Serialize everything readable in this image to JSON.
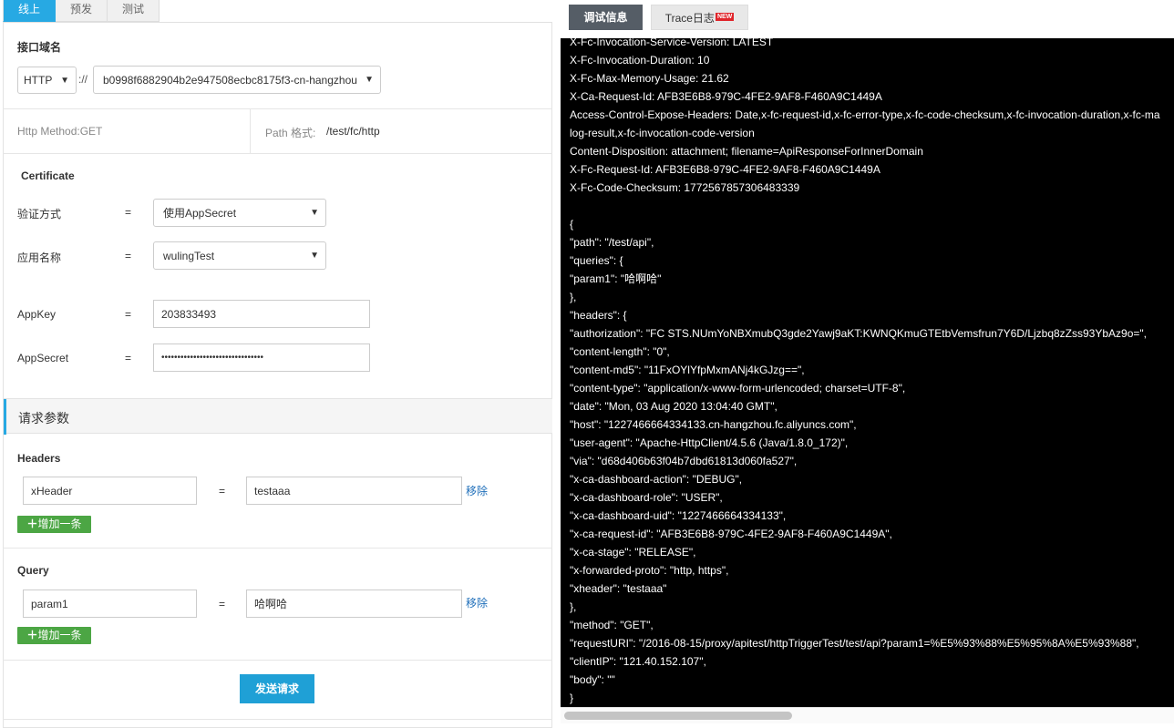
{
  "left": {
    "tabs": [
      "线上",
      "预发",
      "测试"
    ],
    "domain": {
      "title": "接口域名",
      "protocol": "HTTP",
      "separator": "://",
      "host": "b0998f6882904b2e947508ecbc8175f3-cn-hangzhou"
    },
    "method_label": "Http Method:GET",
    "path_label": "Path 格式:",
    "path_value": "/test/fc/http",
    "certificate": {
      "title": "Certificate",
      "auth_label": "验证方式",
      "auth_value": "使用AppSecret",
      "app_label": "应用名称",
      "app_value": "wulingTest",
      "appkey_label": "AppKey",
      "appkey_value": "203833493",
      "appsecret_label": "AppSecret",
      "appsecret_value": "••••••••••••••••••••••••••••••••",
      "eq": "="
    },
    "params": {
      "title": "请求参数",
      "headers_title": "Headers",
      "header_key": "xHeader",
      "header_value": "testaaa",
      "query_title": "Query",
      "query_key": "param1",
      "query_value": "哈啊哈",
      "remove_label": "移除",
      "add_label": "增加一条",
      "add_icon": "plus-icon"
    },
    "send_label": "发送请求"
  },
  "right": {
    "tab_debug": "调试信息",
    "tab_trace": "Trace日志",
    "new_badge": "NEW",
    "lines": [
      "X-Fc-Invocation-Service-Version: LATEST",
      "X-Fc-Invocation-Duration: 10",
      "X-Fc-Max-Memory-Usage: 21.62",
      "X-Ca-Request-Id: AFB3E6B8-979C-4FE2-9AF8-F460A9C1449A",
      "Access-Control-Expose-Headers: Date,x-fc-request-id,x-fc-error-type,x-fc-code-checksum,x-fc-invocation-duration,x-fc-ma",
      "log-result,x-fc-invocation-code-version",
      "Content-Disposition: attachment; filename=ApiResponseForInnerDomain",
      "X-Fc-Request-Id: AFB3E6B8-979C-4FE2-9AF8-F460A9C1449A",
      "X-Fc-Code-Checksum: 1772567857306483339",
      "",
      "{",
      "\"path\": \"/test/api\",",
      "\"queries\": {",
      "\"param1\": \"哈啊哈\"",
      "},",
      "\"headers\": {",
      "\"authorization\": \"FC STS.NUmYoNBXmubQ3gde2Yawj9aKT:KWNQKmuGTEtbVemsfrun7Y6D/Ljzbq8zZss93YbAz9o=\",",
      "\"content-length\": \"0\",",
      "\"content-md5\": \"11FxOYlYfpMxmANj4kGJzg==\",",
      "\"content-type\": \"application/x-www-form-urlencoded; charset=UTF-8\",",
      "\"date\": \"Mon, 03 Aug 2020 13:04:40 GMT\",",
      "\"host\": \"1227466664334133.cn-hangzhou.fc.aliyuncs.com\",",
      "\"user-agent\": \"Apache-HttpClient/4.5.6 (Java/1.8.0_172)\",",
      "\"via\": \"d68d406b63f04b7dbd61813d060fa527\",",
      "\"x-ca-dashboard-action\": \"DEBUG\",",
      "\"x-ca-dashboard-role\": \"USER\",",
      "\"x-ca-dashboard-uid\": \"1227466664334133\",",
      "\"x-ca-request-id\": \"AFB3E6B8-979C-4FE2-9AF8-F460A9C1449A\",",
      "\"x-ca-stage\": \"RELEASE\",",
      "\"x-forwarded-proto\": \"http, https\",",
      "\"xheader\": \"testaaa\"",
      "},",
      "\"method\": \"GET\",",
      "\"requestURI\": \"/2016-08-15/proxy/apitest/httpTriggerTest/test/api?param1=%E5%93%88%E5%95%8A%E5%93%88\",",
      "\"clientIP\": \"121.40.152.107\",",
      "\"body\": \"\"",
      "}"
    ]
  }
}
